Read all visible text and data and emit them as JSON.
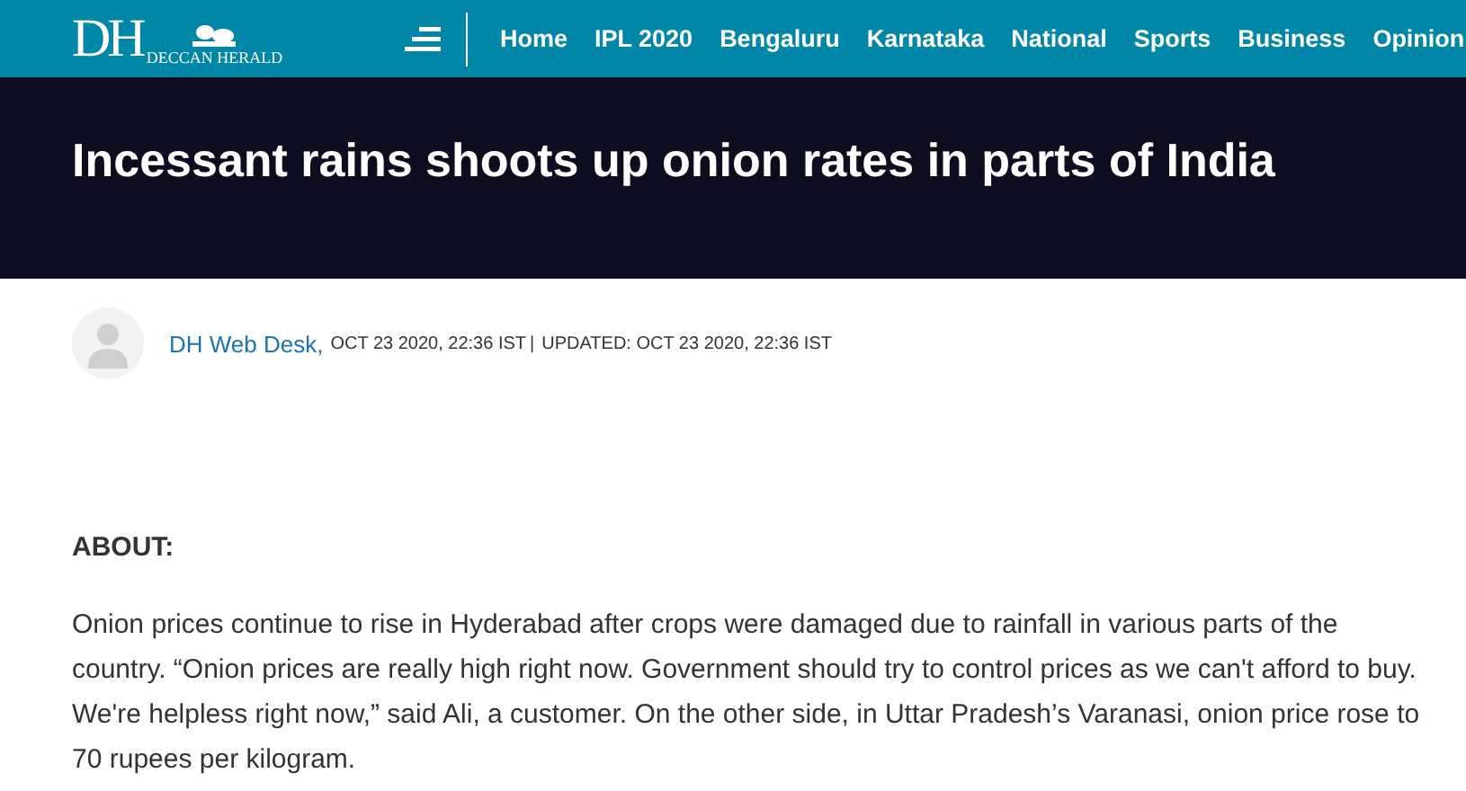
{
  "logo": {
    "mark": "DH",
    "name": "DECCAN HERALD"
  },
  "nav": [
    "Home",
    "IPL 2020",
    "Bengaluru",
    "Karnataka",
    "National",
    "Sports",
    "Business",
    "Opinion"
  ],
  "headline": "Incessant rains shoots up onion rates in parts of India",
  "byline": {
    "author": "DH Web Desk,",
    "published": "OCT 23 2020, 22:36 IST",
    "separator": "|",
    "updated": "UPDATED: OCT 23 2020, 22:36 IST"
  },
  "section_label": "ABOUT:",
  "body": "Onion prices continue to rise in Hyderabad after crops were damaged due to rainfall in various parts of the country. “Onion prices are really high right now. Government should try to control prices as we can't afford to buy. We're helpless right now,” said Ali, a customer. On the other side, in Uttar Pradesh’s Varanasi, onion price rose to 70 rupees per kilogram."
}
